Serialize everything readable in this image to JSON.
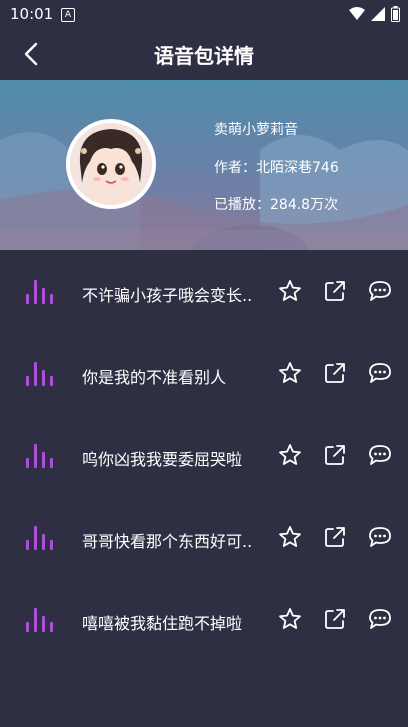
{
  "status": {
    "time": "10:01",
    "a_badge": "A"
  },
  "header": {
    "title": "语音包详情"
  },
  "profile": {
    "name": "卖萌小萝莉音",
    "author": "作者：北陌深巷746",
    "plays": "已播放：284.8万次"
  },
  "items": [
    {
      "title": "不许骗小孩子哦会变长.."
    },
    {
      "title": "你是我的不准看别人"
    },
    {
      "title": "呜你凶我我要委屈哭啦"
    },
    {
      "title": "哥哥快看那个东西好可.."
    },
    {
      "title": "嘻嘻被我黏住跑不掉啦"
    }
  ],
  "colors": {
    "accent": "#b04fdc",
    "background": "#2f2f44"
  },
  "icons": {
    "back": "chevron-left-icon",
    "favorite": "star-icon",
    "share": "share-icon",
    "comment": "comment-icon",
    "audio": "audio-bars-icon"
  }
}
